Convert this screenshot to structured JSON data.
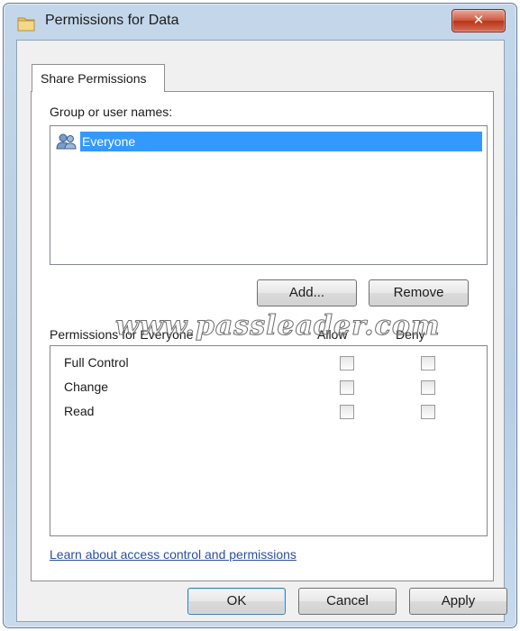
{
  "window": {
    "title": "Permissions for Data",
    "close_label": "✕",
    "icon": "folder-icon"
  },
  "tab": {
    "label": "Share Permissions"
  },
  "group_section": {
    "label": "Group or user names:",
    "items": [
      {
        "name": "Everyone",
        "icon": "users-icon",
        "selected": true
      }
    ]
  },
  "buttons": {
    "add": "Add...",
    "remove": "Remove",
    "ok": "OK",
    "cancel": "Cancel",
    "apply": "Apply"
  },
  "permissions": {
    "header": "Permissions for Everyone",
    "allow_label": "Allow",
    "deny_label": "Deny",
    "rows": [
      {
        "name": "Full Control",
        "allow": false,
        "deny": false
      },
      {
        "name": "Change",
        "allow": false,
        "deny": false
      },
      {
        "name": "Read",
        "allow": false,
        "deny": false
      }
    ]
  },
  "link": {
    "text": "Learn about access control and permissions"
  },
  "watermark": "www.passleader.com",
  "colors": {
    "selection": "#3399ff",
    "link": "#2a4f9f",
    "close_button": "#c8452c"
  }
}
